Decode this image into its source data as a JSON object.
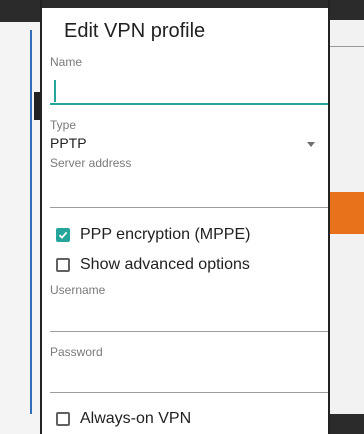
{
  "dialog": {
    "title": "Edit VPN profile",
    "fields": {
      "name": {
        "label": "Name",
        "value": ""
      },
      "type": {
        "label": "Type",
        "value": "PPTP"
      },
      "server_address": {
        "label": "Server address",
        "value": ""
      },
      "username": {
        "label": "Username",
        "value": ""
      },
      "password": {
        "label": "Password",
        "value": ""
      }
    },
    "checkboxes": {
      "ppp_encryption": {
        "label": "PPP encryption (MPPE)",
        "checked": true
      },
      "show_advanced": {
        "label": "Show advanced options",
        "checked": false
      },
      "always_on": {
        "label": "Always-on VPN",
        "checked": false
      }
    }
  },
  "colors": {
    "accent": "#26a69a",
    "badge": "#e8711c"
  }
}
